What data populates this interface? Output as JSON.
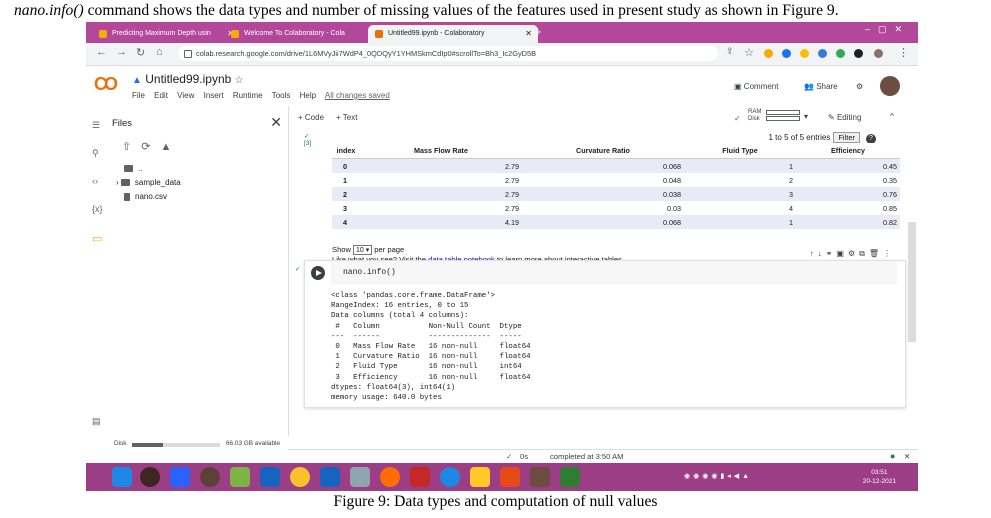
{
  "caption_top": {
    "code": "nano.info()",
    "text": " command shows the data types and number of missing values of the features used in present study as shown in Figure 9."
  },
  "browser": {
    "tabs": [
      {
        "label": "Predicting Maximum Depth usin",
        "active": false
      },
      {
        "label": "Welcome To Colaboratory - Cola",
        "active": false
      },
      {
        "label": "Untitled99.ipynb - Colaboratory",
        "active": true
      }
    ],
    "new_tab": "+",
    "url": "colab.research.google.com/drive/1L6MVyJii7WdP4_0QDQyY1YHMSkmCdIp0#scrollTo=Bh3_Ic2GyD5B"
  },
  "colab": {
    "logo": "CO",
    "title": "Untitled99.ipynb",
    "menu": [
      "File",
      "Edit",
      "View",
      "Insert",
      "Runtime",
      "Tools",
      "Help"
    ],
    "saved": "All changes saved",
    "comment": "Comment",
    "share": "Share",
    "add_code": "+ Code",
    "add_text": "+ Text",
    "ram": "RAM",
    "disk_label": "Disk",
    "editing": "Editing"
  },
  "files": {
    "title": "Files",
    "items": [
      "..",
      "sample_data",
      "nano.csv"
    ],
    "disk_text": "Disk",
    "disk_avail": "66.03 GB available",
    "disk_used_fraction": 0.35
  },
  "cell1": {
    "exec": "[3]",
    "entries_info": "1 to 5 of 5 entries",
    "filter": "Filter",
    "columns": [
      "index",
      "Mass Flow Rate",
      "Curvature Ratio",
      "Fluid Type",
      "Efficiency"
    ],
    "rows": [
      [
        "0",
        "2.79",
        "0.068",
        "1",
        "0.45"
      ],
      [
        "1",
        "2.79",
        "0.048",
        "2",
        "0.35"
      ],
      [
        "2",
        "2.79",
        "0.038",
        "3",
        "0.76"
      ],
      [
        "3",
        "2.79",
        "0.03",
        "4",
        "0.85"
      ],
      [
        "4",
        "4.19",
        "0.068",
        "1",
        "0.82"
      ]
    ],
    "show_label": "Show",
    "show_value": "10",
    "per_page": "per page",
    "like_pre": "Like what you see? Visit the ",
    "like_link": "data table notebook",
    "like_post": " to learn more about interactive tables."
  },
  "cell2": {
    "code": "nano.info()",
    "output": "<class 'pandas.core.frame.DataFrame'>\nRangeIndex: 16 entries, 0 to 15\nData columns (total 4 columns):\n #   Column           Non-Null Count  Dtype  \n---  ------           --------------  -----  \n 0   Mass Flow Rate   16 non-null     float64\n 1   Curvature Ratio  16 non-null     float64\n 2   Fluid Type       16 non-null     int64  \n 3   Efficiency       16 non-null     float64\ndtypes: float64(3), int64(1)\nmemory usage: 640.0 bytes"
  },
  "status": {
    "check": "✓",
    "time": "0s",
    "completed": "completed at 3:50 AM"
  },
  "taskbar": {
    "time": "03:51",
    "date": "20-12-2021"
  },
  "caption_bottom": "Figure 9: Data types and computation of null values",
  "colors": {
    "tab_bar": "#b3479a",
    "taskbar": "#9b3e86",
    "colab_orange": "#f9ab00",
    "row_alt": "#e8ebf5"
  }
}
